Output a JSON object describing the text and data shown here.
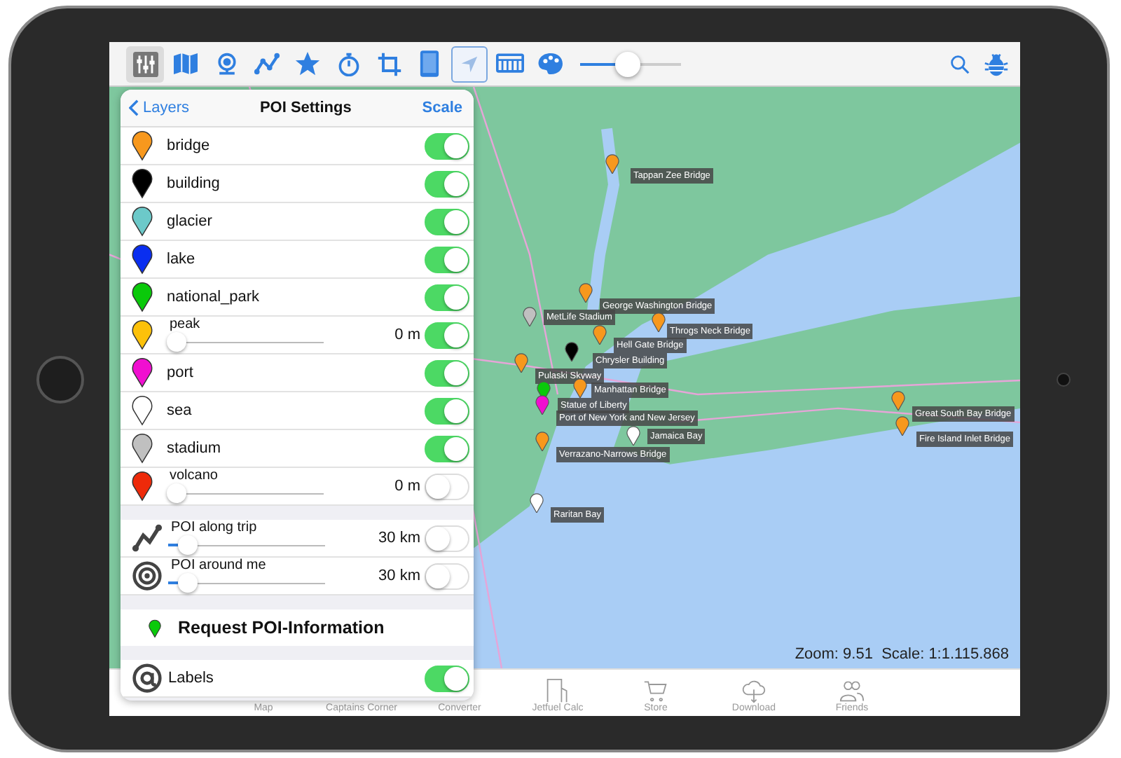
{
  "toolbar": {
    "items": [
      {
        "kind": "layers",
        "selected": true
      },
      {
        "kind": "map",
        "selected": false
      },
      {
        "kind": "globe",
        "selected": false
      },
      {
        "kind": "route",
        "selected": false
      },
      {
        "kind": "star",
        "selected": false
      },
      {
        "kind": "timer",
        "selected": false
      },
      {
        "kind": "crop",
        "selected": false
      },
      {
        "kind": "tablet",
        "selected": false
      },
      {
        "kind": "locate",
        "selected": true
      },
      {
        "kind": "display",
        "selected": false
      },
      {
        "kind": "palette",
        "selected": false
      }
    ],
    "zoom_slider": {
      "level": 0.47
    }
  },
  "panel": {
    "back": "Layers",
    "title": "POI Settings",
    "action": "Scale",
    "poi_types": [
      {
        "kind": "toggle",
        "name": "bridge",
        "color": "#f7981d",
        "on": true
      },
      {
        "kind": "toggle",
        "name": "building",
        "color": "#000000",
        "on": true
      },
      {
        "kind": "toggle",
        "name": "glacier",
        "color": "#6cc9c9",
        "on": true
      },
      {
        "kind": "toggle",
        "name": "lake",
        "color": "#0a2ef0",
        "on": true
      },
      {
        "kind": "toggle",
        "name": "national_park",
        "color": "#0ac90a",
        "on": true
      },
      {
        "kind": "slider",
        "name": "peak",
        "color": "#fcc10a",
        "on": true,
        "level": 0,
        "reading": "0 m"
      },
      {
        "kind": "toggle",
        "name": "port",
        "color": "#f00fd0",
        "on": true
      },
      {
        "kind": "toggle",
        "name": "sea",
        "color": "#ffffff",
        "on": true
      },
      {
        "kind": "toggle",
        "name": "stadium",
        "color": "#c0c0c0",
        "on": true
      },
      {
        "kind": "slider",
        "name": "volcano",
        "color": "#ee2a0a",
        "on": false,
        "level": 0,
        "reading": "0 m"
      }
    ],
    "proximity": [
      {
        "kind": "trip",
        "name": "POI along trip",
        "level": 0.06,
        "reading": "30 km",
        "on": false
      },
      {
        "kind": "around",
        "name": "POI around me",
        "level": 0.06,
        "reading": "30 km",
        "on": false
      }
    ],
    "request": "Request POI-Information",
    "labels": {
      "name": "Labels",
      "on": true
    }
  },
  "map": {
    "markers": [
      {
        "label": "Tappan Zee Bridge",
        "color": "#f7981d"
      },
      {
        "label": "George Washington Bridge",
        "color": "#f7981d"
      },
      {
        "label": "MetLife Stadium",
        "color": "#c0c0c0"
      },
      {
        "label": "Throgs Neck Bridge",
        "color": "#f7981d"
      },
      {
        "label": "Hell Gate Bridge",
        "color": "#f7981d"
      },
      {
        "label": "Chrysler Building",
        "color": "#000000"
      },
      {
        "label": "Pulaski Skyway",
        "color": "#f7981d"
      },
      {
        "label": "Manhattan Bridge",
        "color": "#f7981d"
      },
      {
        "label": "Statue of Liberty",
        "color": "#0ac90a"
      },
      {
        "label": "Port of New York and New Jersey",
        "color": "#f00fd0"
      },
      {
        "label": "Verrazano-Narrows Bridge",
        "color": "#f7981d"
      },
      {
        "label": "Jamaica Bay",
        "color": "#ffffff"
      },
      {
        "label": "Raritan Bay",
        "color": "#ffffff"
      },
      {
        "label": "Great South Bay Bridge",
        "color": "#f7981d"
      },
      {
        "label": "Fire Island Inlet Bridge",
        "color": "#f7981d"
      }
    ],
    "status": "Zoom: 9.51  Scale: 1:1.115.868"
  },
  "tab_bar": [
    "Map",
    "Captains Corner",
    "Converter",
    "Jetfuel Calc",
    "Store",
    "Download",
    "Friends"
  ]
}
